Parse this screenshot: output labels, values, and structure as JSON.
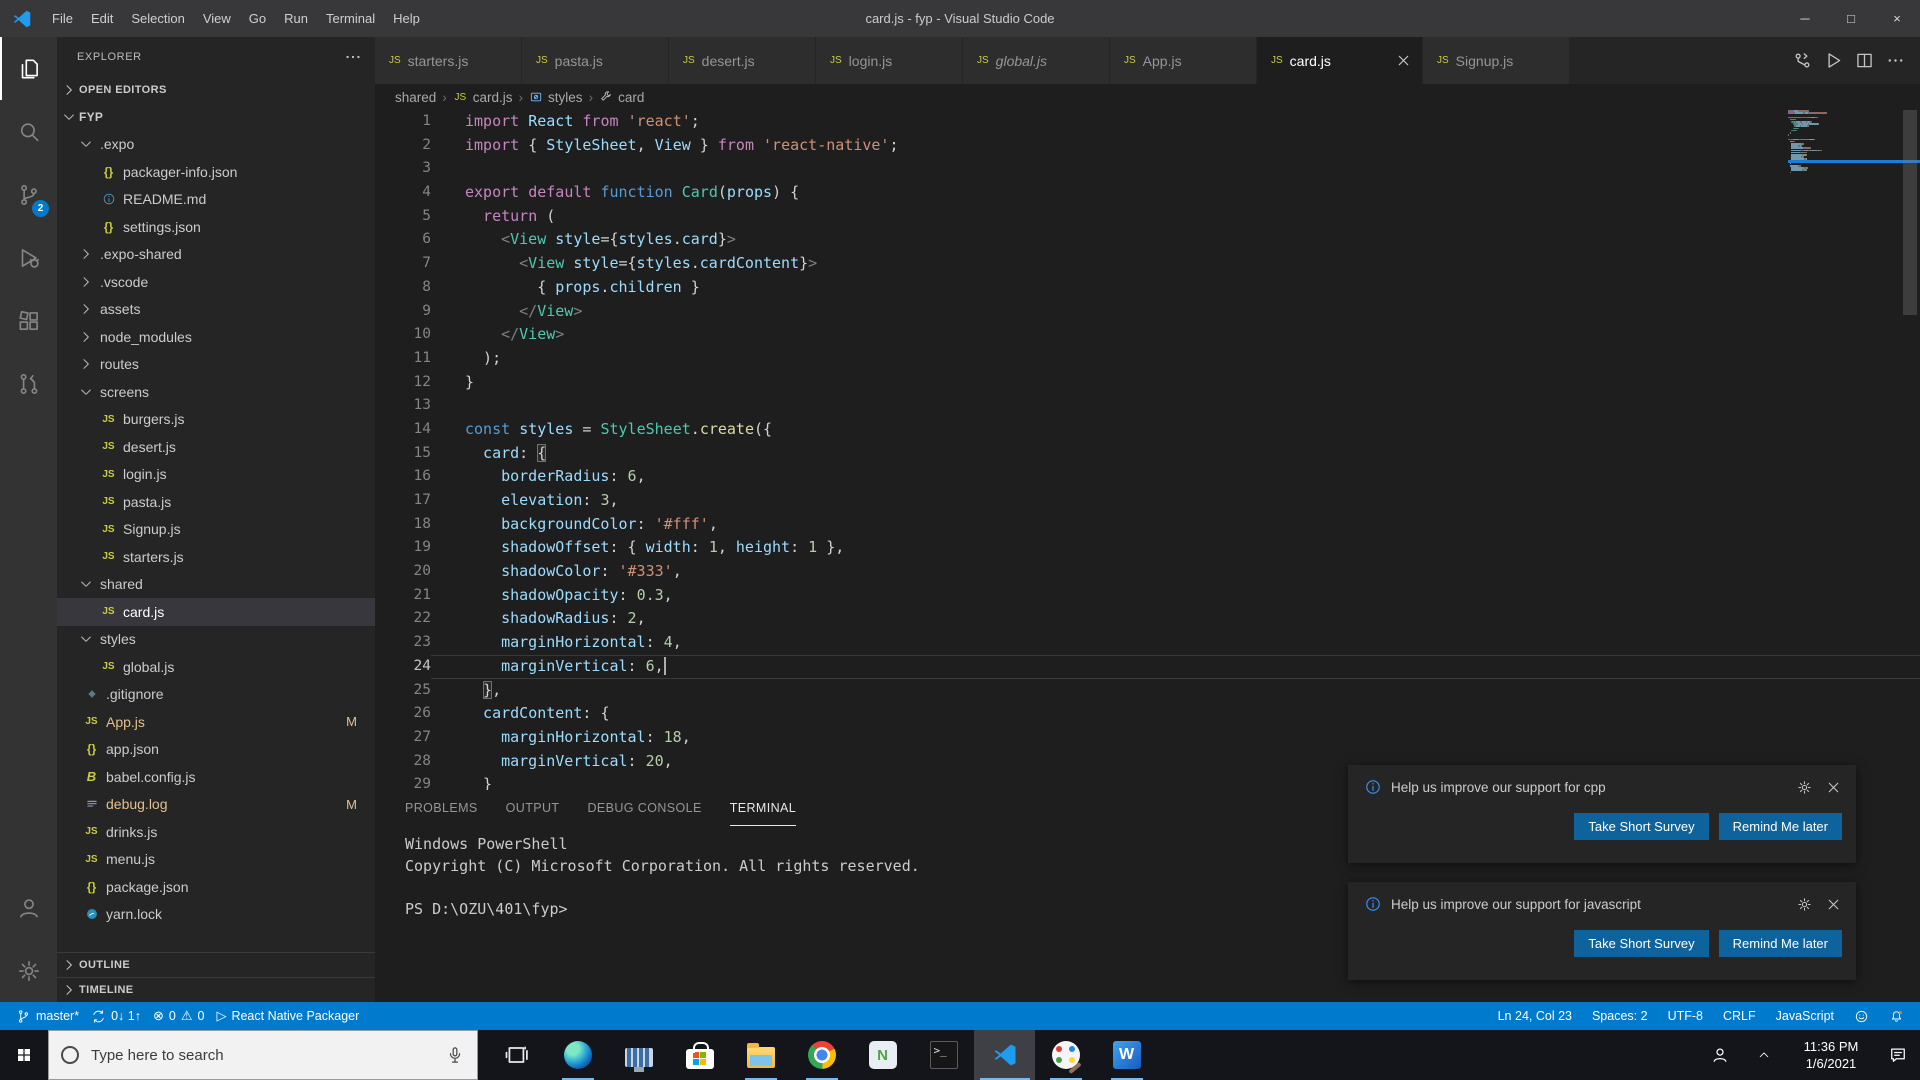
{
  "window": {
    "title": "card.js - fyp - Visual Studio Code",
    "menus": [
      "File",
      "Edit",
      "Selection",
      "View",
      "Go",
      "Run",
      "Terminal",
      "Help"
    ],
    "controls": [
      {
        "name": "minimize",
        "glyph": "─"
      },
      {
        "name": "maximize",
        "glyph": "□"
      },
      {
        "name": "close",
        "glyph": "×"
      }
    ]
  },
  "theme": {
    "accent": "#007acc",
    "statusbar": "#007acc",
    "activity_badge": "#007acc",
    "button": "#0e639c",
    "taskbar_underline": "#76b9ed",
    "modified_file": "#e2c08d"
  },
  "activity_bar": {
    "top": [
      {
        "icon": "files-icon",
        "active": true
      },
      {
        "icon": "search-icon"
      },
      {
        "icon": "source-control-icon",
        "badge": "2"
      },
      {
        "icon": "run-debug-icon"
      },
      {
        "icon": "extensions-icon"
      },
      {
        "icon": "github-pr-icon"
      }
    ],
    "bottom": [
      {
        "icon": "account-icon"
      },
      {
        "icon": "settings-gear-icon"
      }
    ]
  },
  "sidebar": {
    "title": "EXPLORER",
    "open_editors_label": "OPEN EDITORS",
    "root_label": "FYP",
    "tree": [
      {
        "label": "FYP",
        "lvl": 0,
        "fold": "open",
        "root": true
      },
      {
        "label": ".expo",
        "lvl": 1,
        "fold": "open"
      },
      {
        "label": "packager-info.json",
        "lvl": 2,
        "icon": "json"
      },
      {
        "label": "README.md",
        "lvl": 2,
        "icon": "info"
      },
      {
        "label": "settings.json",
        "lvl": 2,
        "icon": "json"
      },
      {
        "label": ".expo-shared",
        "lvl": 1,
        "fold": "closed"
      },
      {
        "label": ".vscode",
        "lvl": 1,
        "fold": "closed"
      },
      {
        "label": "assets",
        "lvl": 1,
        "fold": "closed"
      },
      {
        "label": "node_modules",
        "lvl": 1,
        "fold": "closed"
      },
      {
        "label": "routes",
        "lvl": 1,
        "fold": "closed"
      },
      {
        "label": "screens",
        "lvl": 1,
        "fold": "open"
      },
      {
        "label": "burgers.js",
        "lvl": 2,
        "icon": "js"
      },
      {
        "label": "desert.js",
        "lvl": 2,
        "icon": "js"
      },
      {
        "label": "login.js",
        "lvl": 2,
        "icon": "js"
      },
      {
        "label": "pasta.js",
        "lvl": 2,
        "icon": "js"
      },
      {
        "label": "Signup.js",
        "lvl": 2,
        "icon": "js"
      },
      {
        "label": "starters.js",
        "lvl": 2,
        "icon": "js"
      },
      {
        "label": "shared",
        "lvl": 1,
        "fold": "open"
      },
      {
        "label": "card.js",
        "lvl": 2,
        "icon": "js",
        "selected": true
      },
      {
        "label": "styles",
        "lvl": 1,
        "fold": "open"
      },
      {
        "label": "global.js",
        "lvl": 2,
        "icon": "js"
      },
      {
        "label": ".gitignore",
        "lvl": 1,
        "icon": "git"
      },
      {
        "label": "App.js",
        "lvl": 1,
        "icon": "js",
        "badge": "M"
      },
      {
        "label": "app.json",
        "lvl": 1,
        "icon": "json"
      },
      {
        "label": "babel.config.js",
        "lvl": 1,
        "icon": "babel"
      },
      {
        "label": "debug.log",
        "lvl": 1,
        "icon": "log",
        "badge": "M"
      },
      {
        "label": "drinks.js",
        "lvl": 1,
        "icon": "js"
      },
      {
        "label": "menu.js",
        "lvl": 1,
        "icon": "js"
      },
      {
        "label": "package.json",
        "lvl": 1,
        "icon": "json"
      },
      {
        "label": "yarn.lock",
        "lvl": 1,
        "icon": "yarn"
      }
    ],
    "bottom_sections": [
      {
        "label": "OUTLINE"
      },
      {
        "label": "TIMELINE"
      }
    ]
  },
  "tabs": [
    {
      "label": "starters.js"
    },
    {
      "label": "pasta.js"
    },
    {
      "label": "desert.js"
    },
    {
      "label": "login.js"
    },
    {
      "label": "global.js",
      "preview": true
    },
    {
      "label": "App.js"
    },
    {
      "label": "card.js",
      "active": true
    },
    {
      "label": "Signup.js"
    }
  ],
  "tab_actions": [
    "compare-changes-icon",
    "run-icon",
    "split-editor-icon",
    "more-actions-icon"
  ],
  "breadcrumb": [
    {
      "label": "shared"
    },
    {
      "label": "card.js",
      "icon": "js"
    },
    {
      "label": "styles",
      "icon": "sym"
    },
    {
      "label": "card",
      "icon": "wrench"
    }
  ],
  "editor": {
    "cursor": {
      "line": 24,
      "col": 23
    },
    "lines": [
      {
        "n": 1,
        "ind": 0,
        "t": [
          [
            "import ",
            "kw1"
          ],
          [
            "React",
            "v"
          ],
          [
            " from ",
            "kw1"
          ],
          [
            "'react'",
            "s"
          ],
          [
            ";",
            "p"
          ]
        ]
      },
      {
        "n": 2,
        "ind": 0,
        "t": [
          [
            "import ",
            "kw1"
          ],
          [
            "{ ",
            "p"
          ],
          [
            "StyleSheet",
            "v"
          ],
          [
            ", ",
            "p"
          ],
          [
            "View",
            "v"
          ],
          [
            " } ",
            "p"
          ],
          [
            "from ",
            "kw1"
          ],
          [
            "'react-native'",
            "s"
          ],
          [
            ";",
            "p"
          ]
        ]
      },
      {
        "n": 3,
        "ind": 0,
        "t": []
      },
      {
        "n": 4,
        "ind": 0,
        "t": [
          [
            "export ",
            "kw1"
          ],
          [
            "default ",
            "kw1"
          ],
          [
            "function ",
            "kw2"
          ],
          [
            "Card",
            "c"
          ],
          [
            "(",
            "p"
          ],
          [
            "props",
            "v"
          ],
          [
            ") {",
            "p"
          ]
        ]
      },
      {
        "n": 5,
        "ind": 1,
        "t": [
          [
            "return",
            "kw1"
          ],
          [
            " (",
            "p"
          ]
        ]
      },
      {
        "n": 6,
        "ind": 2,
        "t": [
          [
            "<",
            "t"
          ],
          [
            "View",
            "c"
          ],
          [
            " ",
            "p"
          ],
          [
            "style",
            "v"
          ],
          [
            "={",
            "p"
          ],
          [
            "styles",
            "v"
          ],
          [
            ".",
            "p"
          ],
          [
            "card",
            "v"
          ],
          [
            "}",
            "p"
          ],
          [
            ">",
            "t"
          ]
        ]
      },
      {
        "n": 7,
        "ind": 3,
        "t": [
          [
            "<",
            "t"
          ],
          [
            "View",
            "c"
          ],
          [
            " ",
            "p"
          ],
          [
            "style",
            "v"
          ],
          [
            "={",
            "p"
          ],
          [
            "styles",
            "v"
          ],
          [
            ".",
            "p"
          ],
          [
            "cardContent",
            "v"
          ],
          [
            "}",
            "p"
          ],
          [
            ">",
            "t"
          ]
        ]
      },
      {
        "n": 8,
        "ind": 4,
        "t": [
          [
            "{ ",
            "p"
          ],
          [
            "props",
            "v"
          ],
          [
            ".",
            "p"
          ],
          [
            "children",
            "v"
          ],
          [
            " }",
            "p"
          ]
        ]
      },
      {
        "n": 9,
        "ind": 3,
        "t": [
          [
            "</",
            "t"
          ],
          [
            "View",
            "c"
          ],
          [
            ">",
            "t"
          ]
        ]
      },
      {
        "n": 10,
        "ind": 2,
        "t": [
          [
            "</",
            "t"
          ],
          [
            "View",
            "c"
          ],
          [
            ">",
            "t"
          ]
        ]
      },
      {
        "n": 11,
        "ind": 1,
        "t": [
          [
            ");",
            "p"
          ]
        ]
      },
      {
        "n": 12,
        "ind": 0,
        "t": [
          [
            "}",
            "p"
          ]
        ]
      },
      {
        "n": 13,
        "ind": 0,
        "t": []
      },
      {
        "n": 14,
        "ind": 0,
        "t": [
          [
            "const ",
            "kw2"
          ],
          [
            "styles",
            "v"
          ],
          [
            " = ",
            "p"
          ],
          [
            "StyleSheet",
            "c"
          ],
          [
            ".",
            "p"
          ],
          [
            "create",
            "f"
          ],
          [
            "({",
            "p"
          ]
        ]
      },
      {
        "n": 15,
        "ind": 1,
        "t": [
          [
            "card",
            "v"
          ],
          [
            ": ",
            "p"
          ],
          [
            "{",
            "p m"
          ]
        ]
      },
      {
        "n": 16,
        "ind": 2,
        "t": [
          [
            "borderRadius",
            "v"
          ],
          [
            ": ",
            "p"
          ],
          [
            "6",
            "n"
          ],
          [
            ",",
            "p"
          ]
        ]
      },
      {
        "n": 17,
        "ind": 2,
        "t": [
          [
            "elevation",
            "v"
          ],
          [
            ": ",
            "p"
          ],
          [
            "3",
            "n"
          ],
          [
            ",",
            "p"
          ]
        ]
      },
      {
        "n": 18,
        "ind": 2,
        "t": [
          [
            "backgroundColor",
            "v"
          ],
          [
            ": ",
            "p"
          ],
          [
            "'#fff'",
            "s"
          ],
          [
            ",",
            "p"
          ]
        ]
      },
      {
        "n": 19,
        "ind": 2,
        "t": [
          [
            "shadowOffset",
            "v"
          ],
          [
            ": { ",
            "p"
          ],
          [
            "width",
            "v"
          ],
          [
            ": ",
            "p"
          ],
          [
            "1",
            "n"
          ],
          [
            ", ",
            "p"
          ],
          [
            "height",
            "v"
          ],
          [
            ": ",
            "p"
          ],
          [
            "1",
            "n"
          ],
          [
            " },",
            "p"
          ]
        ]
      },
      {
        "n": 20,
        "ind": 2,
        "t": [
          [
            "shadowColor",
            "v"
          ],
          [
            ": ",
            "p"
          ],
          [
            "'#333'",
            "s"
          ],
          [
            ",",
            "p"
          ]
        ]
      },
      {
        "n": 21,
        "ind": 2,
        "t": [
          [
            "shadowOpacity",
            "v"
          ],
          [
            ": ",
            "p"
          ],
          [
            "0.3",
            "n"
          ],
          [
            ",",
            "p"
          ]
        ]
      },
      {
        "n": 22,
        "ind": 2,
        "t": [
          [
            "shadowRadius",
            "v"
          ],
          [
            ": ",
            "p"
          ],
          [
            "2",
            "n"
          ],
          [
            ",",
            "p"
          ]
        ]
      },
      {
        "n": 23,
        "ind": 2,
        "t": [
          [
            "marginHorizontal",
            "v"
          ],
          [
            ": ",
            "p"
          ],
          [
            "4",
            "n"
          ],
          [
            ",",
            "p"
          ]
        ]
      },
      {
        "n": 24,
        "ind": 2,
        "t": [
          [
            "marginVertical",
            "v"
          ],
          [
            ": ",
            "p"
          ],
          [
            "6",
            "n"
          ],
          [
            ",",
            "p"
          ]
        ],
        "current": true,
        "cursor": true
      },
      {
        "n": 25,
        "ind": 1,
        "t": [
          [
            "}",
            "p m"
          ],
          [
            ",",
            "p"
          ]
        ]
      },
      {
        "n": 26,
        "ind": 1,
        "t": [
          [
            "cardContent",
            "v"
          ],
          [
            ": {",
            "p"
          ]
        ]
      },
      {
        "n": 27,
        "ind": 2,
        "t": [
          [
            "marginHorizontal",
            "v"
          ],
          [
            ": ",
            "p"
          ],
          [
            "18",
            "n"
          ],
          [
            ",",
            "p"
          ]
        ]
      },
      {
        "n": 28,
        "ind": 2,
        "t": [
          [
            "marginVertical",
            "v"
          ],
          [
            ": ",
            "p"
          ],
          [
            "20",
            "n"
          ],
          [
            ",",
            "p"
          ]
        ]
      },
      {
        "n": 29,
        "ind": 1,
        "t": [
          [
            "}",
            "p"
          ]
        ]
      }
    ]
  },
  "panel": {
    "tabs": [
      "PROBLEMS",
      "OUTPUT",
      "DEBUG CONSOLE",
      "TERMINAL"
    ],
    "active_tab": "TERMINAL",
    "terminal_lines": [
      "Windows PowerShell",
      "Copyright (C) Microsoft Corporation. All rights reserved.",
      "",
      "PS D:\\OZU\\401\\fyp>"
    ]
  },
  "notifications": [
    {
      "title": "Help us improve our support for cpp",
      "buttons": [
        "Take Short Survey",
        "Remind Me later"
      ]
    },
    {
      "title": "Help us improve our support for javascript",
      "buttons": [
        "Take Short Survey",
        "Remind Me later"
      ]
    }
  ],
  "status_bar": {
    "left": [
      {
        "name": "git-branch-status",
        "parts": [
          {
            "i": "branch"
          },
          {
            "t": "master*"
          }
        ]
      },
      {
        "name": "sync-status",
        "parts": [
          {
            "i": "sync"
          },
          {
            "t": "0↓ 1↑"
          }
        ]
      },
      {
        "name": "problems-status",
        "parts": [
          {
            "g": "⊗"
          },
          {
            "t": "0"
          },
          {
            "g": "⚠"
          },
          {
            "t": "0"
          }
        ]
      },
      {
        "name": "react-native-packager",
        "parts": [
          {
            "g": "▷"
          },
          {
            "t": "React Native Packager"
          }
        ]
      }
    ],
    "right": [
      {
        "name": "cursor-position",
        "parts": [
          {
            "t": "Ln 24, Col 23"
          }
        ]
      },
      {
        "name": "indentation",
        "parts": [
          {
            "t": "Spaces: 2"
          }
        ]
      },
      {
        "name": "encoding",
        "parts": [
          {
            "t": "UTF-8"
          }
        ]
      },
      {
        "name": "eol",
        "parts": [
          {
            "t": "CRLF"
          }
        ]
      },
      {
        "name": "language-mode",
        "parts": [
          {
            "t": "JavaScript"
          }
        ]
      },
      {
        "name": "feedback",
        "parts": [
          {
            "i": "feedback"
          }
        ]
      },
      {
        "name": "notifications-bell",
        "parts": [
          {
            "i": "bell"
          }
        ]
      }
    ]
  },
  "taskbar": {
    "search_placeholder": "Type here to search",
    "apps": [
      {
        "name": "task-view",
        "kind": "taskview"
      },
      {
        "name": "edge",
        "kind": "edge",
        "running": true
      },
      {
        "name": "on-screen-keyboard",
        "kind": "keyboard"
      },
      {
        "name": "microsoft-store",
        "kind": "store"
      },
      {
        "name": "file-explorer",
        "kind": "folder",
        "running": true
      },
      {
        "name": "chrome",
        "kind": "chrome",
        "running": true
      },
      {
        "name": "notepad-plus-plus",
        "kind": "npp",
        "label": "N"
      },
      {
        "name": "command-prompt",
        "kind": "cmd",
        "label": ">_"
      },
      {
        "name": "vscode",
        "kind": "vscode",
        "running": true,
        "active": true
      },
      {
        "name": "paint",
        "kind": "paint",
        "running": true
      },
      {
        "name": "word",
        "kind": "word",
        "label": "W",
        "running": true
      }
    ],
    "tray": {
      "time": "11:36 PM",
      "date": "1/6/2021"
    }
  }
}
